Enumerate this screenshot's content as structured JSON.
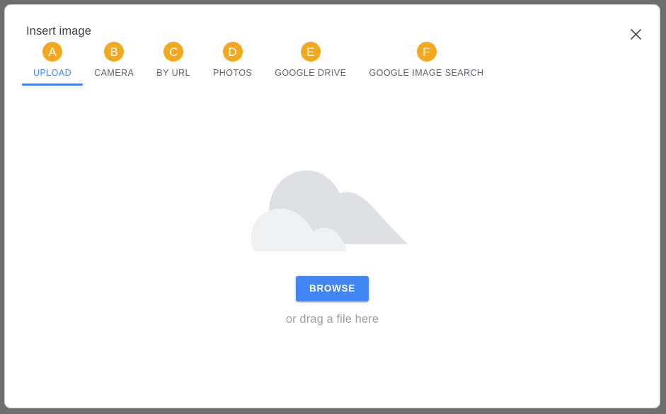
{
  "dialog": {
    "title": "Insert image",
    "close_icon": "close-icon"
  },
  "tabs": [
    {
      "badge": "A",
      "label": "UPLOAD",
      "active": true
    },
    {
      "badge": "B",
      "label": "CAMERA",
      "active": false
    },
    {
      "badge": "C",
      "label": "BY URL",
      "active": false
    },
    {
      "badge": "D",
      "label": "PHOTOS",
      "active": false
    },
    {
      "badge": "E",
      "label": "GOOGLE DRIVE",
      "active": false
    },
    {
      "badge": "F",
      "label": "GOOGLE IMAGE SEARCH",
      "active": false
    }
  ],
  "dropzone": {
    "illustration": "cloud-upload-illustration",
    "browse_label": "BROWSE",
    "drag_hint": "or drag a file here"
  },
  "colors": {
    "badge": "#f4a81d",
    "accent": "#4285f4",
    "cloud_back": "#dee0e3",
    "cloud_front": "#eef0f2",
    "label": "#5f6368",
    "hint": "#9aa0a6",
    "backdrop": "#6e6e6e",
    "surface": "#ffffff"
  }
}
